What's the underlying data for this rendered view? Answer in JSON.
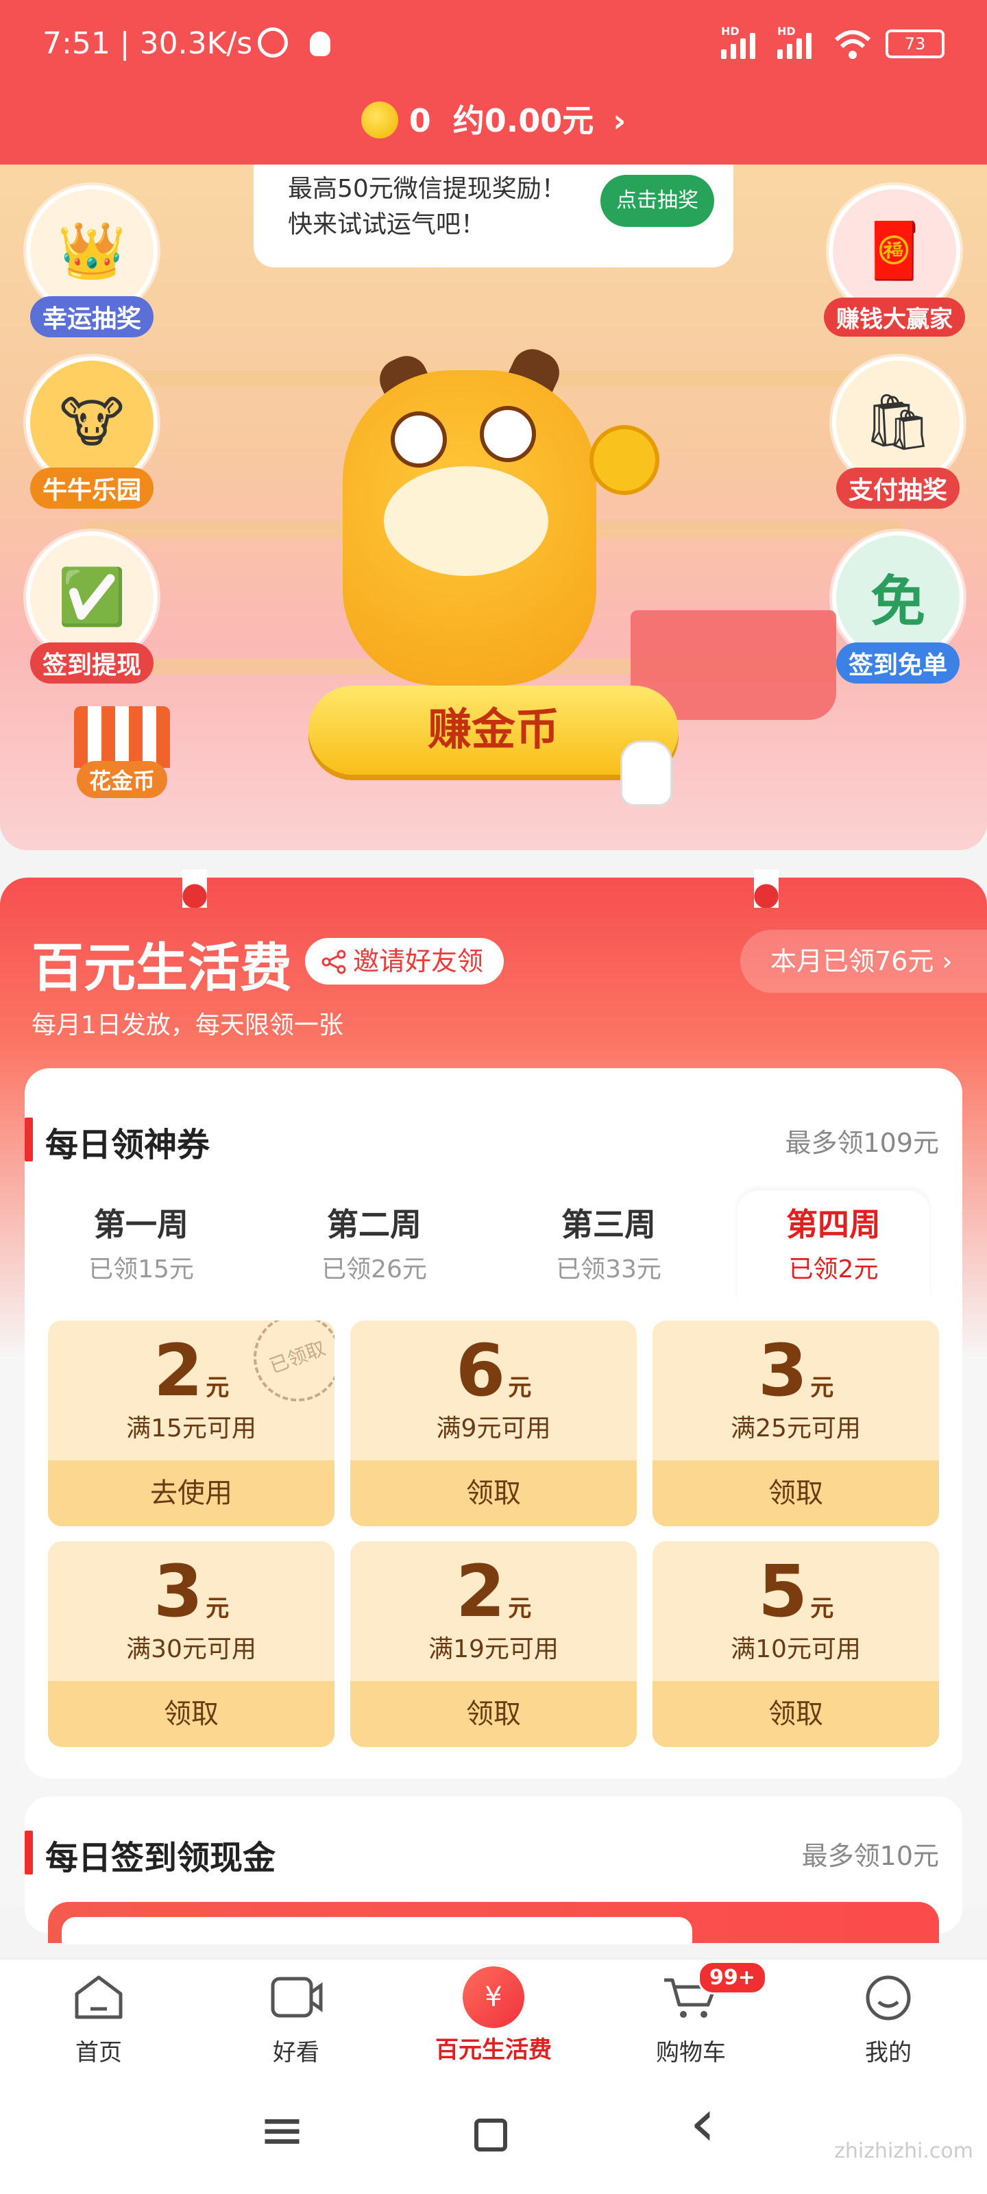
{
  "status_bar": {
    "time_speed": "7:51 | 30.3K/s",
    "battery": "73",
    "alarm_icon": "alarm-icon",
    "qq_icon": "qq-icon"
  },
  "header": {
    "coin_count": "0",
    "coin_value": "约0.00元",
    "chevron": "›"
  },
  "hero": {
    "bubble_text_1": "最高50元微信提现奖励！",
    "bubble_text_2": "快来试试运气吧！",
    "bubble_button": "点击抽奖",
    "left_features": [
      "幸运抽奖",
      "牛牛乐园",
      "签到提现",
      "花金币"
    ],
    "right_features": [
      "赚钱大赢家",
      "支付抽奖",
      "签到免单"
    ],
    "earn_button": "赚金币"
  },
  "life": {
    "title": "百元生活费",
    "invite": "邀请好友领",
    "month_received": "本月已领76元 ›",
    "subtitle": "每月1日发放，每天限领一张"
  },
  "daily_coupon": {
    "title": "每日领神券",
    "max": "最多领109元",
    "weeks": [
      {
        "name": "第一周",
        "received": "已领15元"
      },
      {
        "name": "第二周",
        "received": "已领26元"
      },
      {
        "name": "第三周",
        "received": "已领33元"
      },
      {
        "name": "第四周",
        "received": "已领2元"
      }
    ],
    "unit": "元",
    "coupons": [
      {
        "amount": "2",
        "condition": "满15元可用",
        "action": "去使用",
        "stamp": "已领取"
      },
      {
        "amount": "6",
        "condition": "满9元可用",
        "action": "领取"
      },
      {
        "amount": "3",
        "condition": "满25元可用",
        "action": "领取"
      },
      {
        "amount": "3",
        "condition": "满30元可用",
        "action": "领取"
      },
      {
        "amount": "2",
        "condition": "满19元可用",
        "action": "领取"
      },
      {
        "amount": "5",
        "condition": "满10元可用",
        "action": "领取"
      }
    ]
  },
  "daily_checkin": {
    "title": "每日签到领现金",
    "max": "最多领10元"
  },
  "bottom_nav": {
    "items": [
      "首页",
      "好看",
      "百元生活费",
      "购物车",
      "我的"
    ],
    "cart_badge": "99+"
  },
  "system_nav": {
    "menu": "≡",
    "home": "□",
    "back": "‹"
  },
  "watermark": "zhizhizhi.com",
  "colors": {
    "brand_red": "#f65152",
    "accent_red": "#e02020",
    "coupon_bg": "#fdebc9",
    "coupon_btn": "#fbd78f",
    "coin_gold": "#f8be19"
  }
}
